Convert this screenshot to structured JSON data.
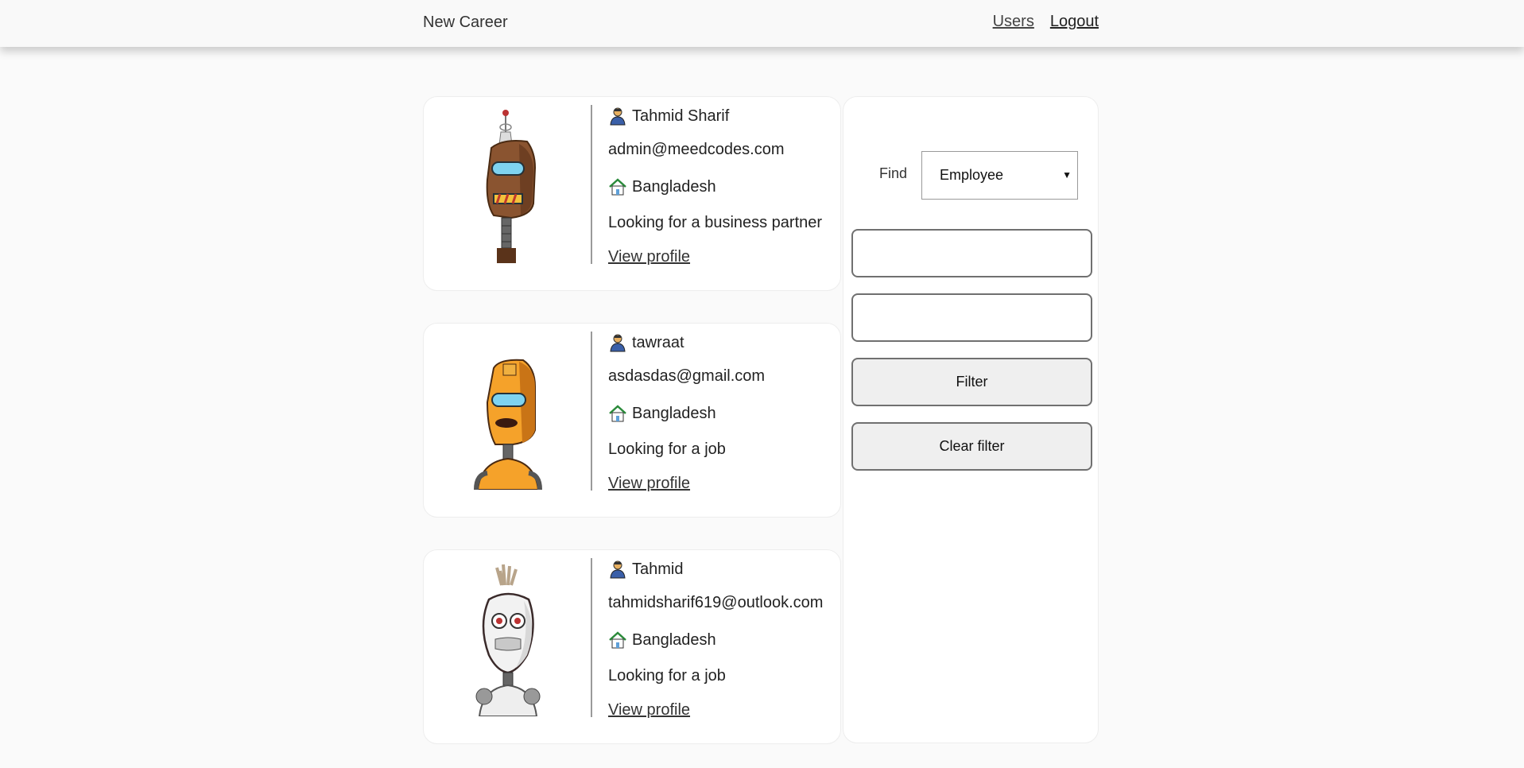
{
  "header": {
    "brand": "New Career",
    "nav": [
      "Users",
      "Logout"
    ]
  },
  "cards": [
    {
      "name": "Tahmid Sharif",
      "email": "admin@meedcodes.com",
      "country": "Bangladesh",
      "status": "Looking for a business partner",
      "link": "View profile"
    },
    {
      "name": "tawraat",
      "email": "asdasdas@gmail.com",
      "country": "Bangladesh",
      "status": "Looking for a job",
      "link": "View profile"
    },
    {
      "name": "Tahmid",
      "email": "tahmidsharif619@outlook.com",
      "country": "Bangladesh",
      "status": "Looking for a job",
      "link": "View profile"
    }
  ],
  "filter": {
    "find_label": "Find",
    "select_value": "Employee",
    "input1_value": "",
    "input2_value": "",
    "filter_button": "Filter",
    "clear_button": "Clear filter"
  },
  "icons": {
    "person": "person-icon",
    "home": "home-icon",
    "caret": "caret-down-icon"
  }
}
